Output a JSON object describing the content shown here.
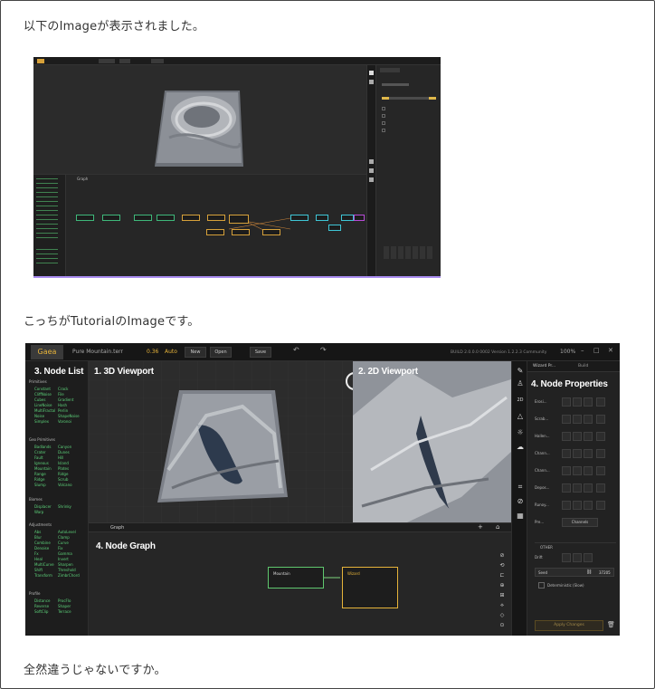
{
  "text": {
    "line1": "以下のImageが表示されました。",
    "line2": "こっちがTutorialのImageです。",
    "line3": "全然違うじゃないですか。"
  },
  "shot1": {
    "tab_graph": "Graph",
    "tab_props": "Property Editor"
  },
  "shot2": {
    "app_name": "Gaea",
    "file_name": "Pure Mountain.terr",
    "build": "0.36",
    "auto": "Auto",
    "new": "New",
    "open": "Open",
    "save": "Save",
    "version": "BUILD 2.0.0.0 0002 Version 1.2.2.3 Community",
    "zoom": "100%",
    "labels": {
      "node_list": "3. Node List",
      "viewport3d": "1. 3D Viewport",
      "viewport2d": "2. 2D Viewport",
      "node_props": "4. Node Properties",
      "node_graph": "4. Node Graph"
    },
    "graph_tab": "Graph",
    "props_header": "Wizard Pr...",
    "props_tab": "Build",
    "list_sections": [
      "Primitives",
      "Geo Primitives",
      "Biomes",
      "Adjustments",
      "Profile"
    ],
    "list_col1": [
      "Constant",
      "CliffNoise",
      "Cubes",
      "LineNoise",
      "MultiFractal",
      "Noise",
      "Simplex"
    ],
    "list_col2": [
      "Crack",
      "File",
      "Gradient",
      "Hash",
      "Perlin",
      "ShapeNoise",
      "Voronoi"
    ],
    "geo_col1": [
      "Badlands",
      "Crater",
      "Fault",
      "Igneous",
      "Mountain",
      "Range",
      "Ridge",
      "Slump"
    ],
    "geo_col2": [
      "Canyon",
      "Dunes",
      "Hill",
      "Island",
      "Plates",
      "Ridge",
      "Scrub",
      "Volcano"
    ],
    "bio_col1": [
      "Displacer",
      "Warp"
    ],
    "bio_col2": [
      "Shrinky"
    ],
    "adj_col1": [
      "Abs",
      "Blur",
      "Combine",
      "Denoise",
      "Fx",
      "Heal",
      "MultiCurve",
      "Shift",
      "Transform"
    ],
    "adj_col2": [
      "AutoLevel",
      "Clamp",
      "Curve",
      "Fix",
      "Gamma",
      "Invert",
      "Sharpen",
      "Threshold",
      "ZimbrChord"
    ],
    "prof_col1": [
      "Distance",
      "Reverse",
      "SoftClip"
    ],
    "prof_col2": [
      "ProcFlo",
      "Shaper",
      "Terrace"
    ],
    "props_rows": [
      {
        "label": "Erosi..."
      },
      {
        "label": "Scrab..."
      },
      {
        "label": "Hallen..."
      },
      {
        "label": "Chann..."
      },
      {
        "label": "Chann..."
      },
      {
        "label": "Depos..."
      },
      {
        "label": "Runoy..."
      },
      {
        "label": "Pre..."
      }
    ],
    "pre_value": "Channels",
    "other": "OTHER",
    "drift": "Drift",
    "seed_label": "Seed",
    "seed_value": "37205",
    "deterministic": "Deterministic (Slow)",
    "apply": "Apply Changes",
    "node_mountain": "Mountain",
    "node_wizard": "Wizard"
  },
  "colors": {
    "accent": "#e6b33a",
    "green": "#5dd27a"
  }
}
